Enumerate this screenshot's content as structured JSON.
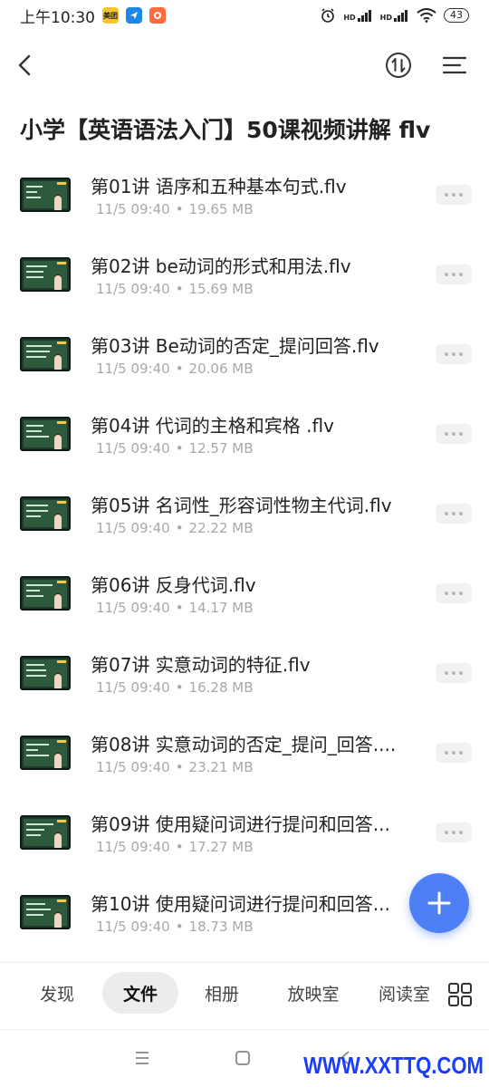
{
  "status_bar": {
    "time": "上午10:30",
    "app_badges": [
      "美团",
      "",
      ""
    ],
    "network_labels": [
      "HD",
      "HD"
    ],
    "battery": "43"
  },
  "header": {
    "title": "小学【英语语法入门】50课视频讲解 flv"
  },
  "files": [
    {
      "name": "第01讲 语序和五种基本句式.flv",
      "date": "11/5 09:40",
      "size": "19.65 MB"
    },
    {
      "name": "第02讲 be动词的形式和用法.flv",
      "date": "11/5 09:40",
      "size": "15.69 MB"
    },
    {
      "name": "第03讲 Be动词的否定_提问回答.flv",
      "date": "11/5 09:40",
      "size": "20.06 MB"
    },
    {
      "name": "第04讲 代词的主格和宾格 .flv",
      "date": "11/5 09:40",
      "size": "12.57 MB"
    },
    {
      "name": "第05讲 名词性_形容词性物主代词.flv",
      "date": "11/5 09:40",
      "size": "22.22 MB"
    },
    {
      "name": "第06讲 反身代词.flv",
      "date": "11/5 09:40",
      "size": "14.17 MB"
    },
    {
      "name": "第07讲 实意动词的特征.flv",
      "date": "11/5 09:40",
      "size": "16.28 MB"
    },
    {
      "name": "第08讲 实意动词的否定_提问_回答....",
      "date": "11/5 09:40",
      "size": "23.21 MB"
    },
    {
      "name": "第09讲 使用疑问词进行提问和回答...",
      "date": "11/5 09:40",
      "size": "17.27 MB"
    },
    {
      "name": "第10讲 使用疑问词进行提问和回答...",
      "date": "11/5 09:40",
      "size": "18.73 MB"
    }
  ],
  "meta_separator": "•",
  "bottom_tabs": [
    {
      "label": "发现"
    },
    {
      "label": "文件"
    },
    {
      "label": "相册"
    },
    {
      "label": "放映室"
    },
    {
      "label": "阅读室"
    }
  ],
  "active_tab": "文件",
  "watermark": "WWW.XXTTQ.COM",
  "colors": {
    "accent": "#4f7ff5",
    "meta_text": "#a8a8a8",
    "watermark": "#1a3cff"
  },
  "icons": {
    "back": "chevron-left-icon",
    "sort": "sort-icon",
    "menu": "menu-icon",
    "more": "more-icon",
    "add": "plus-icon",
    "grid": "grid-icon"
  }
}
